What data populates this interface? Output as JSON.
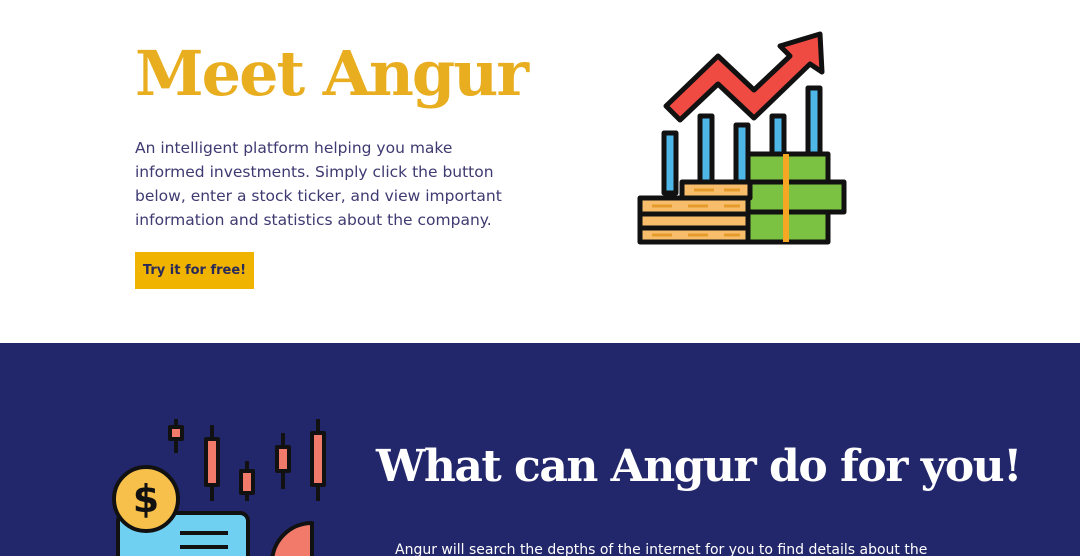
{
  "hero": {
    "title": "Meet Angur",
    "description": "An intelligent platform helping you make informed investments. Simply click the button below, enter a stock ticker, and view important information and statistics about the company.",
    "cta_label": "Try it for free!",
    "illustration_icon": "growth-chart-money-icon"
  },
  "features": {
    "title": "What can Angur do for you!",
    "description": "Angur will search the depths of the internet for you to find details about the",
    "illustration_icon": "candlestick-finance-icon"
  },
  "colors": {
    "accent": "#e8ae1f",
    "button": "#f0b400",
    "body_text": "#3e3a72",
    "section_background": "#22266a"
  }
}
